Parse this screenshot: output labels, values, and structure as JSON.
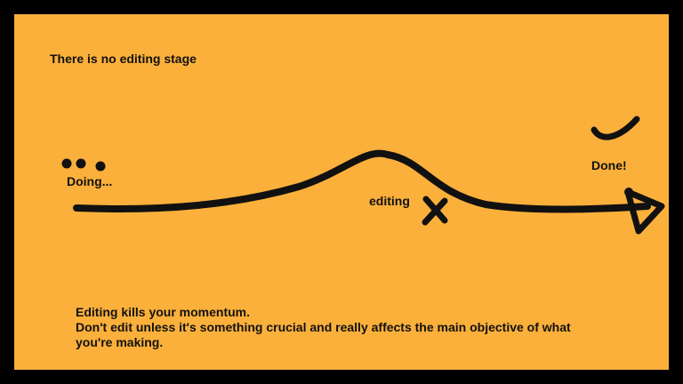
{
  "slide": {
    "background_color": "#FBB03B",
    "frame_color": "#000000",
    "ink_color": "#111111",
    "title": "There is no editing stage",
    "doing_label": "Doing...",
    "editing_label": "editing",
    "done_label": "Done!",
    "note": {
      "line1": "Editing kills your momentum.",
      "line2": "Don't edit unless it's something crucial and really affects the main objective of what",
      "line3": "you're making."
    },
    "icons": {
      "doing": "ellipsis-dots-icon",
      "editing": "cross-mark-icon",
      "done": "check-mark-icon",
      "path_end": "arrow-head-icon"
    }
  }
}
